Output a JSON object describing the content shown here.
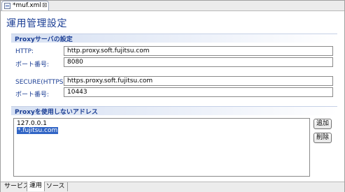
{
  "editor_tab": {
    "title": "*muf.xml",
    "close_glyph": "⊠",
    "icon": "xml-file-icon"
  },
  "page_title": "運用管理設定",
  "proxy_section": {
    "title": "Proxyサーバの設定",
    "http_label": "HTTP:",
    "http_value": "http.proxy.soft.fujitsu.com",
    "http_port_label": "ポート番号:",
    "http_port_value": "8080",
    "https_label": "SECURE(HTTPS):",
    "https_value": "https.proxy.soft.fujitsu.com",
    "https_port_label": "ポート番号:",
    "https_port_value": "10443"
  },
  "bypass_section": {
    "title": "Proxyを使用しないアドレス",
    "addresses": [
      {
        "value": "127.0.0.1",
        "selected": false
      },
      {
        "value": "*.fujitsu.com",
        "selected": true
      }
    ],
    "add_label": "追加",
    "delete_label": "削除"
  },
  "page_tabs": [
    {
      "label": "サービス",
      "active": false
    },
    {
      "label": "運用",
      "active": true
    },
    {
      "label": "ソース",
      "active": false
    }
  ],
  "colors": {
    "heading": "#1c3f95",
    "selection": "#3165c5",
    "section_gradient": "#d6e0f2"
  }
}
